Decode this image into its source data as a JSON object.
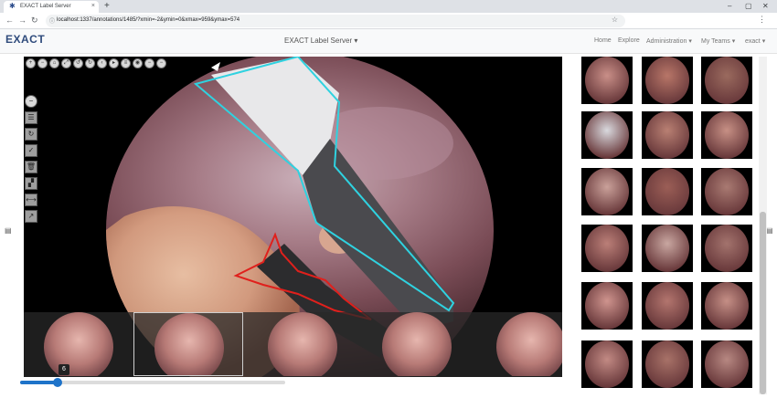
{
  "browser": {
    "tab_title": "EXACT Label Server",
    "tab_close": "×",
    "new_tab": "+",
    "url": "localhost:1337/annotations/1485/?xmin=-2&ymin=0&xmax=959&ymax=574",
    "window_controls": [
      "–",
      "▢",
      "✕"
    ]
  },
  "navbar": {
    "logo": "EXACT",
    "brand": "EXACT Label Server",
    "items": [
      {
        "label": "Home"
      },
      {
        "label": "Explore"
      },
      {
        "label": "Administration"
      },
      {
        "label": "My Teams"
      },
      {
        "label": "exact"
      }
    ]
  },
  "viewer": {
    "frame_tooltip": "6",
    "slider_value": 0.14,
    "frames": 5,
    "selected_frame": 1
  },
  "gallery": {
    "columns": 3,
    "rows": 6,
    "tones": [
      "#c98f88",
      "#b87668",
      "#9a6a5e",
      "#d9d9de",
      "#b98073",
      "#c79085",
      "#caa19a",
      "#9b5e56",
      "#a97a72",
      "#bb7f78",
      "#c9a7a1",
      "#a3736d",
      "#cf948e",
      "#b3756e",
      "#c58f86",
      "#c28a84",
      "#a87268",
      "#b78882"
    ]
  },
  "colors": {
    "accent": "#1e73c9",
    "annotation_cyan": "#2fd2e0",
    "annotation_red": "#e0201c"
  }
}
